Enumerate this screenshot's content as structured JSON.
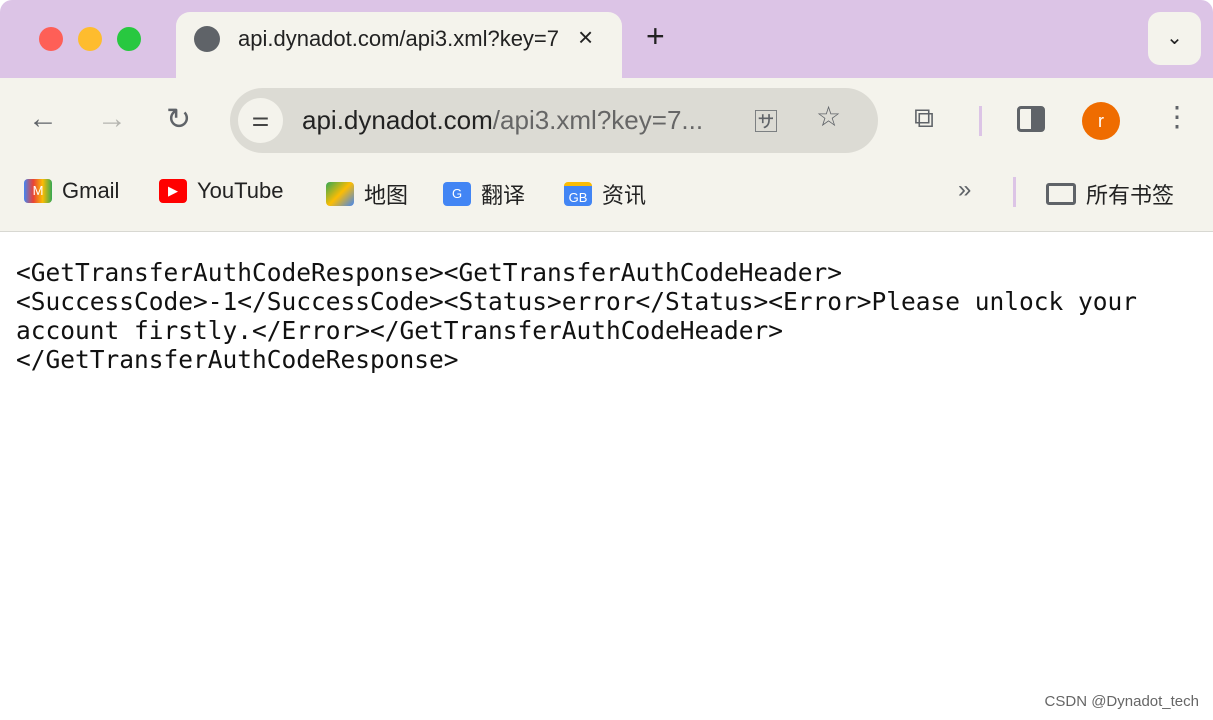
{
  "tab": {
    "title": "api.dynadot.com/api3.xml?key=7...",
    "close": "×",
    "new_tab": "+"
  },
  "omnibox": {
    "domain": "api.dynadot.com",
    "path": "/api3.xml?key=7..."
  },
  "profile": {
    "initial": "r",
    "color": "#ef6c00"
  },
  "bookmarks": [
    {
      "label": "Gmail",
      "icon": "gmail-icon"
    },
    {
      "label": "YouTube",
      "icon": "youtube-icon"
    },
    {
      "label": "地图",
      "icon": "maps-icon"
    },
    {
      "label": "翻译",
      "icon": "translate-icon"
    },
    {
      "label": "资讯",
      "icon": "news-icon"
    }
  ],
  "all_bookmarks": "所有书签",
  "content": {
    "lines": [
      "<GetTransferAuthCodeResponse><GetTransferAuthCodeHeader>",
      "<SuccessCode>-1</SuccessCode><Status>error</Status><Error>Please unlock your",
      "account firstly.</Error></GetTransferAuthCodeHeader>",
      "</GetTransferAuthCodeResponse>"
    ]
  },
  "watermark": "CSDN @Dynadot_tech"
}
